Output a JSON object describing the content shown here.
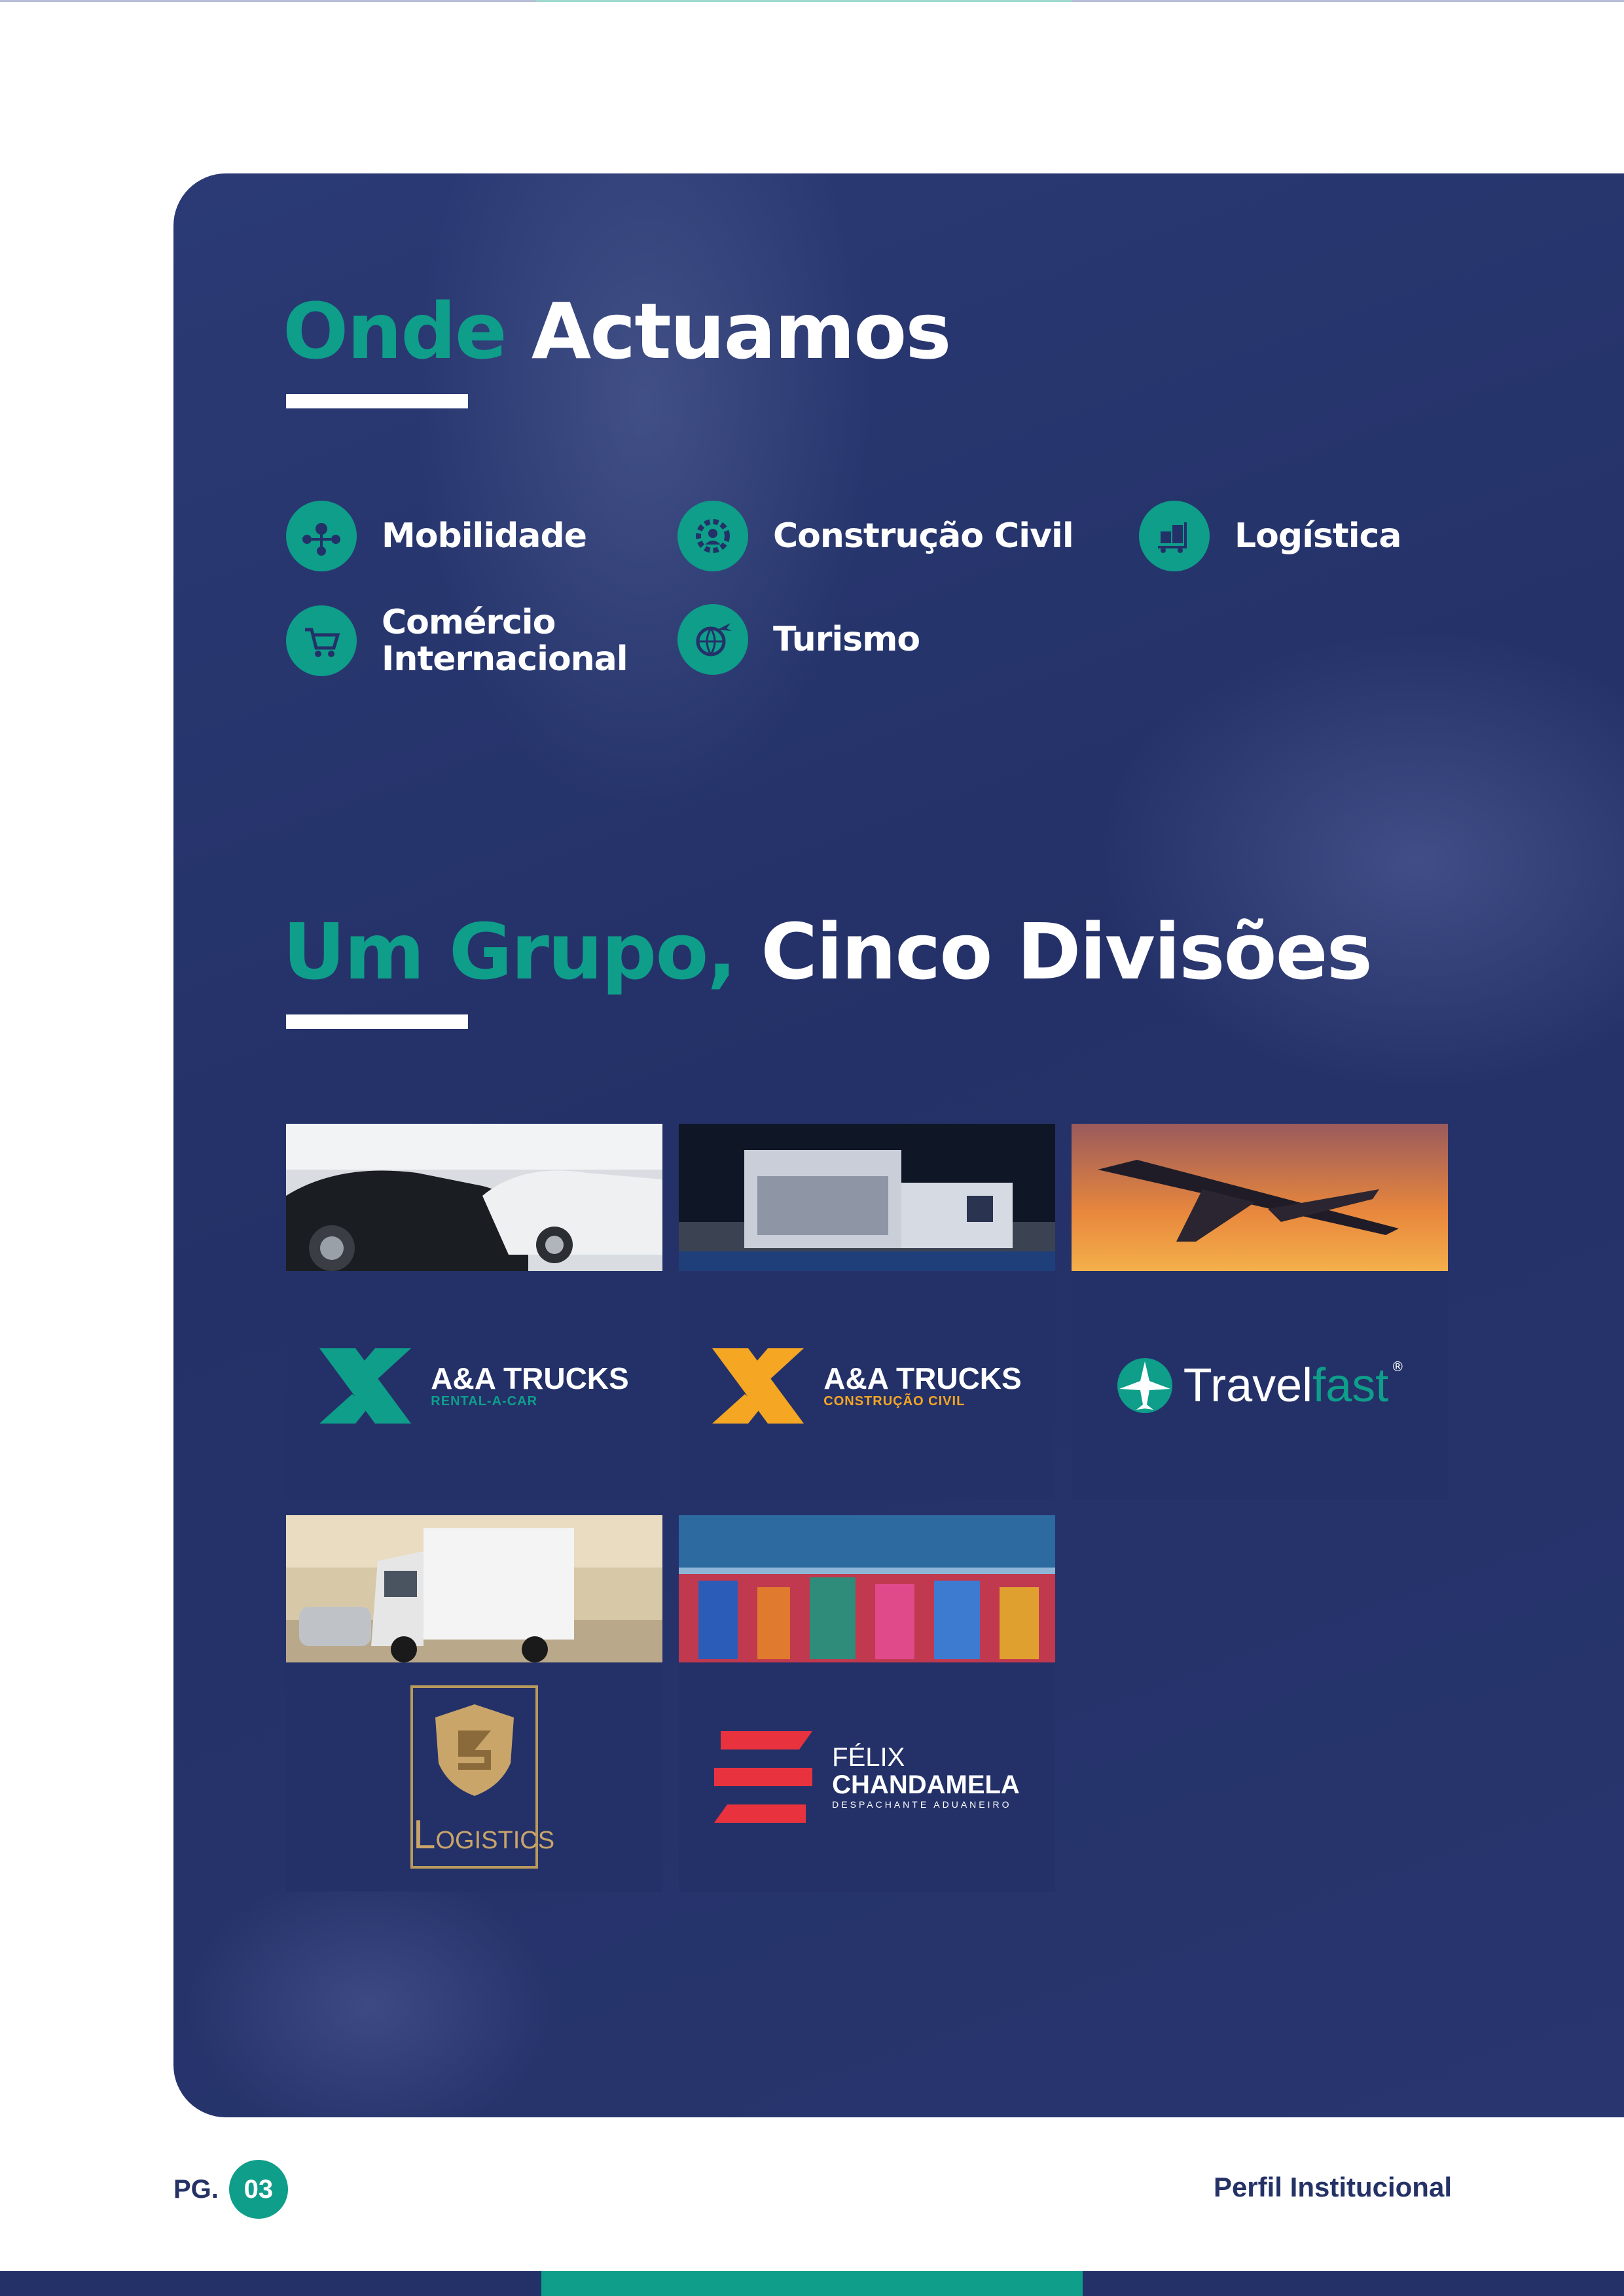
{
  "colors": {
    "navy": "#243168",
    "teal": "#0e9e8a",
    "white": "#ffffff"
  },
  "section1": {
    "title_accent": "Onde",
    "title_rest": "Actuamos",
    "sectors": [
      {
        "label": "Mobilidade",
        "icon": "network-pin-icon"
      },
      {
        "label": "Construção Civil",
        "icon": "gear-worker-icon"
      },
      {
        "label": "Logística",
        "icon": "cart-boxes-icon"
      },
      {
        "label_line1": "Comércio",
        "label_line2": "Internacional",
        "icon": "shopping-cart-icon"
      },
      {
        "label": "Turismo",
        "icon": "globe-plane-icon"
      }
    ]
  },
  "section2": {
    "title_accent": "Um Grupo,",
    "title_rest": "Cinco Divisões"
  },
  "divisions": [
    {
      "name": "A&A TRUCKS",
      "sub": "RENTAL-A-CAR",
      "accent": "#0e9e8a",
      "photo": "cars-showroom"
    },
    {
      "name": "A&A TRUCKS",
      "sub": "CONSTRUÇÃO CIVIL",
      "accent": "#f5a623",
      "photo": "building-night"
    },
    {
      "name_a": "Travel",
      "name_b": "fast",
      "mark": "®",
      "photo": "airplane-sunset"
    },
    {
      "name": "OGISTICS",
      "initial": "L",
      "photo": "truck"
    },
    {
      "name_line1": "FÉLIX",
      "name_line2": "CHANDAMELA",
      "sub": "DESPACHANTE ADUANEIRO",
      "photo": "containers-port"
    }
  ],
  "footer": {
    "page_label": "PG.",
    "page_number": "03",
    "doc_title": "Perfil Institucional"
  }
}
